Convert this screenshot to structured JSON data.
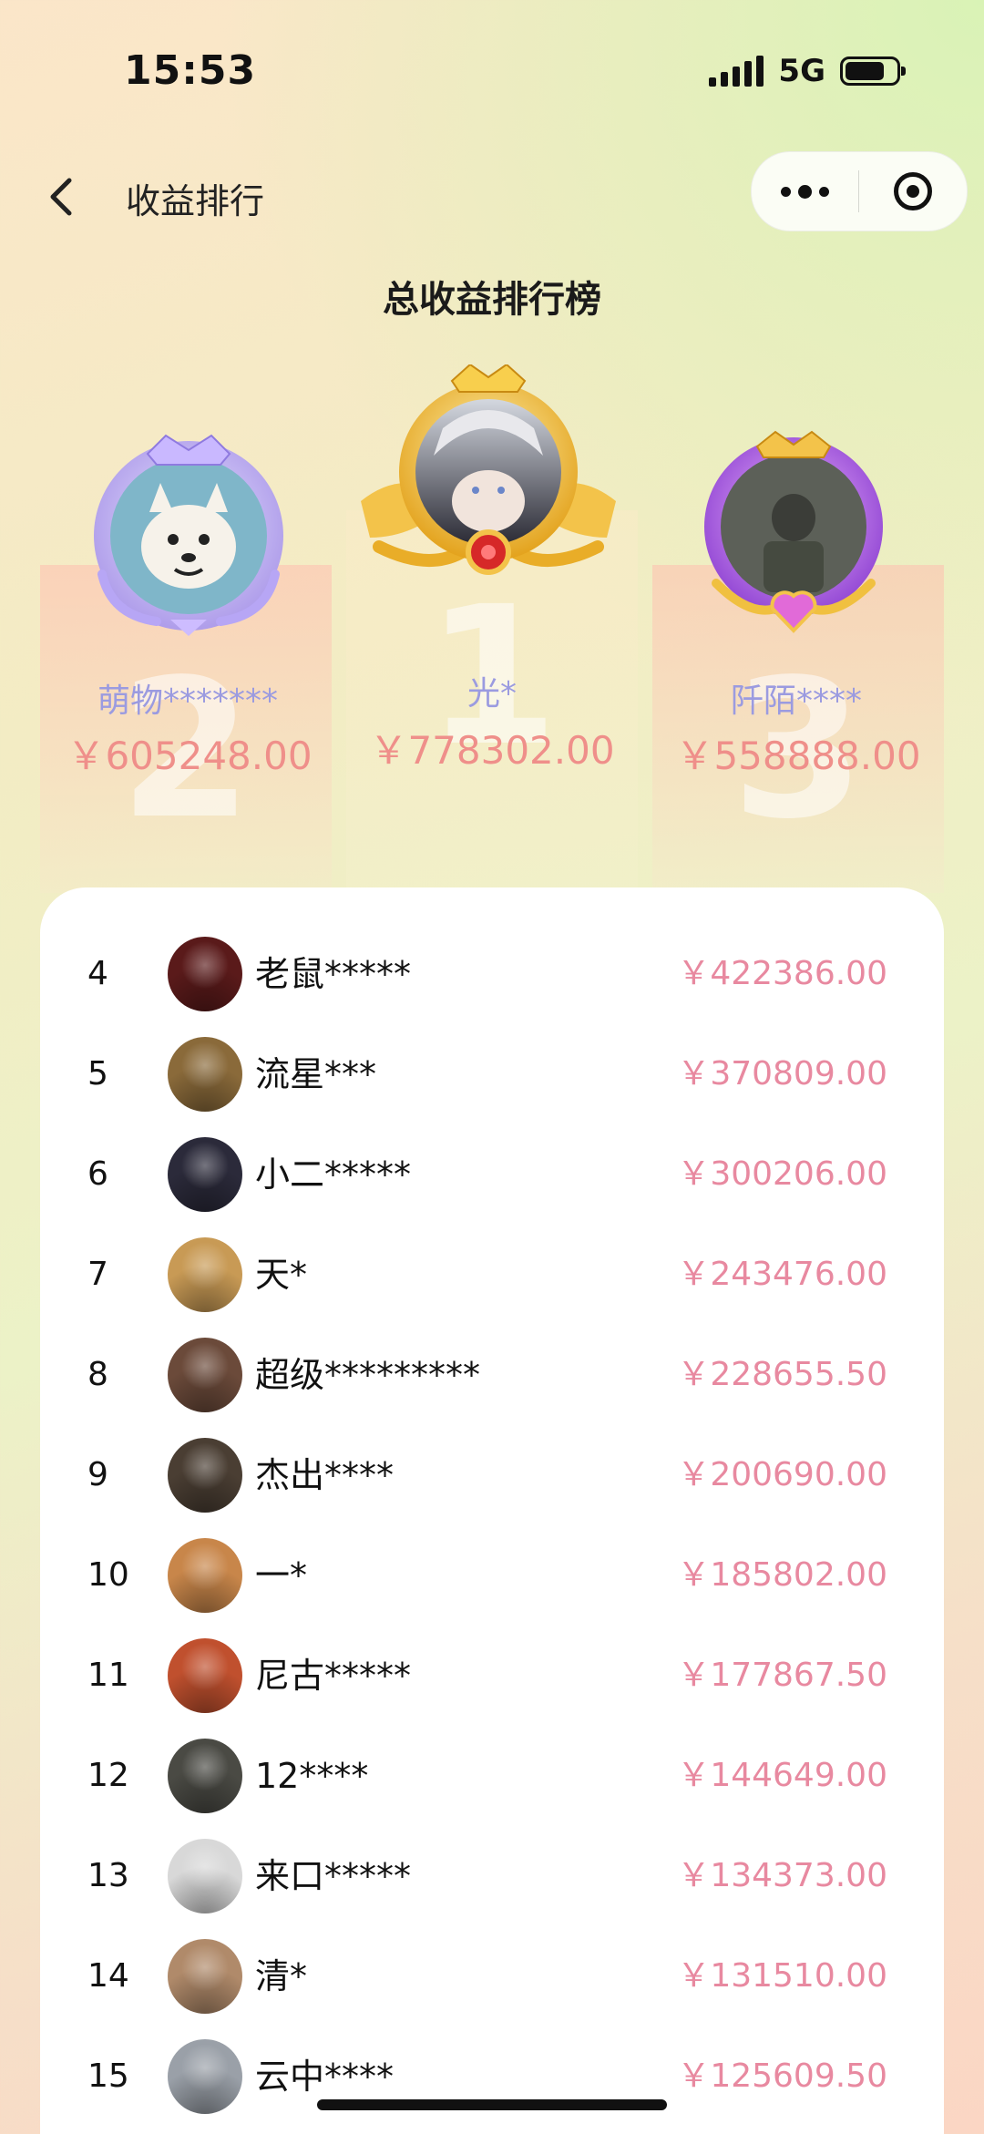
{
  "status_bar": {
    "time": "15:53",
    "network": "5G"
  },
  "nav": {
    "title": "收益排行"
  },
  "board": {
    "title": "总收益排行榜"
  },
  "podium": [
    {
      "rank": "2",
      "name": "萌物*******",
      "amount": "￥605248.00"
    },
    {
      "rank": "1",
      "name": "光*",
      "amount": "￥778302.00"
    },
    {
      "rank": "3",
      "name": "阡陌****",
      "amount": "￥558888.00"
    }
  ],
  "list": [
    {
      "rank": "4",
      "name": "老鼠*****",
      "amount": "￥422386.00",
      "avatar_color": "#5a1a1a"
    },
    {
      "rank": "5",
      "name": "流星***",
      "amount": "￥370809.00",
      "avatar_color": "#8a6a3a"
    },
    {
      "rank": "6",
      "name": "小二*****",
      "amount": "￥300206.00",
      "avatar_color": "#2b2a3a"
    },
    {
      "rank": "7",
      "name": "天*",
      "amount": "￥243476.00",
      "avatar_color": "#c89a55"
    },
    {
      "rank": "8",
      "name": "超级*********",
      "amount": "￥228655.50",
      "avatar_color": "#6b4a3a"
    },
    {
      "rank": "9",
      "name": "杰出****",
      "amount": "￥200690.00",
      "avatar_color": "#4a3e33"
    },
    {
      "rank": "10",
      "name": "一*",
      "amount": "￥185802.00",
      "avatar_color": "#c8864a"
    },
    {
      "rank": "11",
      "name": "尼古*****",
      "amount": "￥177867.50",
      "avatar_color": "#c0502e"
    },
    {
      "rank": "12",
      "name": "12****",
      "amount": "￥144649.00",
      "avatar_color": "#4a4a44"
    },
    {
      "rank": "13",
      "name": "来口*****",
      "amount": "￥134373.00",
      "avatar_color": "#d8d8d8"
    },
    {
      "rank": "14",
      "name": "清*",
      "amount": "￥131510.00",
      "avatar_color": "#b08a6a"
    },
    {
      "rank": "15",
      "name": "云中****",
      "amount": "￥125609.50",
      "avatar_color": "#9aa0a8"
    }
  ],
  "icons": {
    "back": "chevron-left-icon",
    "more": "more-dots-icon",
    "close": "target-close-icon"
  }
}
